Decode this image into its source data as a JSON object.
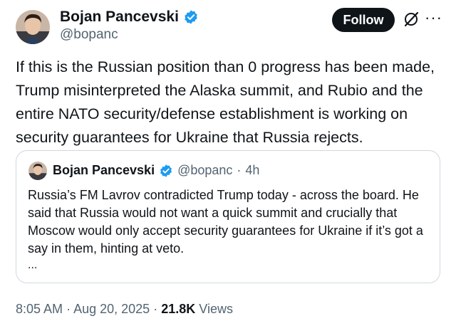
{
  "author": {
    "display_name": "Bojan Pancevski",
    "handle": "@bopanc",
    "verified": true,
    "avatar_icon": "profile-photo"
  },
  "actions": {
    "follow_label": "Follow",
    "grok_icon": "grok-icon",
    "more_icon": "more-icon"
  },
  "tweet": {
    "text": "If this is the Russian position than 0 progress has been made, Trump misinterpreted the Alaska summit, and Rubio and the entire NATO security/defense establishment is working on security guarantees for Ukraine that Russia rejects."
  },
  "quote": {
    "display_name": "Bojan Pancevski",
    "handle": "@bopanc",
    "separator": "·",
    "time": "4h",
    "text": "Russia’s FM Lavrov contradicted Trump today - across the board. He said  that Russia would not want a quick summit and crucially that Moscow would only accept security guarantees for Ukraine if it’s got a say in them, hinting at veto.",
    "ellipsis": "..."
  },
  "meta": {
    "time": "8:05 AM",
    "sep1": "·",
    "date": "Aug 20, 2025",
    "sep2": "·",
    "views_count": "21.8K",
    "views_label": "Views"
  },
  "colors": {
    "verified": "#1d9bf0",
    "secondary_text": "#536471",
    "border": "#cfd9de",
    "follow_bg": "#0f1419"
  }
}
